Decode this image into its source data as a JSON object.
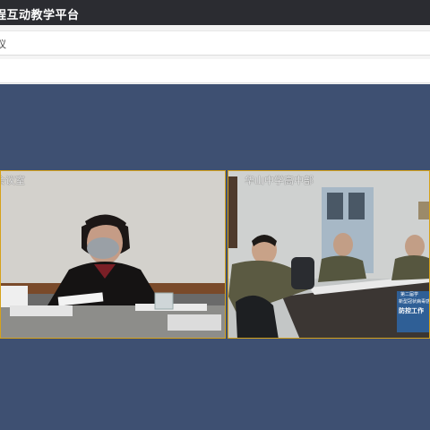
{
  "app": {
    "title": "程互动教学平台"
  },
  "breadcrumb": {
    "text": "议"
  },
  "videos": [
    {
      "label": "会议室"
    },
    {
      "label": "华山中学高中部"
    }
  ],
  "banner": {
    "line1": "第二届学",
    "line2": "新型冠状病毒感",
    "line3": "防控工作"
  }
}
